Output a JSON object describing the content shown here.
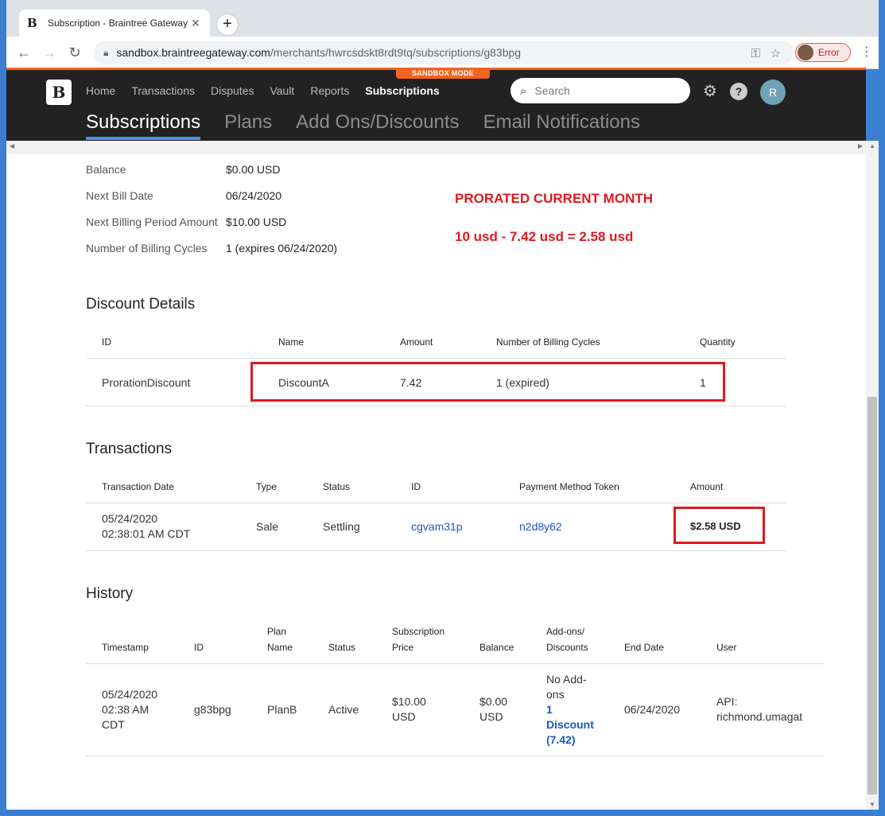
{
  "browser": {
    "tab_title": "Subscription - Braintree Gateway",
    "tab_favicon": "B",
    "close_tab": "✕",
    "new_tab": "+",
    "url_host": "sandbox.braintreegateway.com",
    "url_path": "/merchants/hwrcsdskt8rdt9tq/subscriptions/g83bpg",
    "profile_status": "Error",
    "window_min": "▁",
    "window_max": "☐",
    "window_close": "✕"
  },
  "app": {
    "sandbox_label": "SANDBOX MODE",
    "logo": "B",
    "nav": [
      "Home",
      "Transactions",
      "Disputes",
      "Vault",
      "Reports",
      "Subscriptions"
    ],
    "search_placeholder": "Search",
    "avatar_initial": "R",
    "subnav": [
      "Subscriptions",
      "Plans",
      "Add Ons/Discounts",
      "Email Notifications"
    ]
  },
  "summary": {
    "rows": [
      {
        "label": "Balance",
        "value": "$0.00 USD"
      },
      {
        "label": "Next Bill Date",
        "value": "06/24/2020"
      },
      {
        "label": "Next Billing Period Amount",
        "value": "$10.00 USD"
      },
      {
        "label": "Number of Billing Cycles",
        "value": "1 (expires 06/24/2020)"
      }
    ]
  },
  "annotation": {
    "line1": "PRORATED CURRENT MONTH",
    "line2": "10 usd - 7.42 usd = 2.58 usd",
    "color": "#e0191f"
  },
  "discounts": {
    "title": "Discount Details",
    "headers": [
      "ID",
      "Name",
      "Amount",
      "Number of Billing Cycles",
      "Quantity"
    ],
    "row": {
      "id": "ProrationDiscount",
      "name": "DiscountA",
      "amount": "7.42",
      "cycles": "1 (expired)",
      "quantity": "1"
    }
  },
  "transactions": {
    "title": "Transactions",
    "headers": [
      "Transaction Date",
      "Type",
      "Status",
      "ID",
      "Payment Method Token",
      "Amount"
    ],
    "row": {
      "date1": "05/24/2020",
      "date2": "02:38:01 AM CDT",
      "type": "Sale",
      "status": "Settling",
      "id": "cgvam31p",
      "token": "n2d8y62",
      "amount": "$2.58 USD"
    }
  },
  "history": {
    "title": "History",
    "headers": {
      "timestamp": "Timestamp",
      "id": "ID",
      "plan1": "Plan",
      "plan2": "Name",
      "status": "Status",
      "price1": "Subscription",
      "price2": "Price",
      "balance": "Balance",
      "addons1": "Add-ons/",
      "addons2": "Discounts",
      "end": "End Date",
      "user": "User"
    },
    "row": {
      "ts1": "05/24/2020",
      "ts2": "02:38 AM",
      "ts3": "CDT",
      "id": "g83bpg",
      "plan": "PlanB",
      "status": "Active",
      "price1": "$10.00",
      "price2": "USD",
      "balance1": "$0.00",
      "balance2": "USD",
      "addon1": "No Add-",
      "addon2": "ons",
      "disc1": "1",
      "disc2": "Discount",
      "disc3": "(7.42)",
      "end": "06/24/2020",
      "user1": "API:",
      "user2": "richmond.umagat"
    }
  }
}
